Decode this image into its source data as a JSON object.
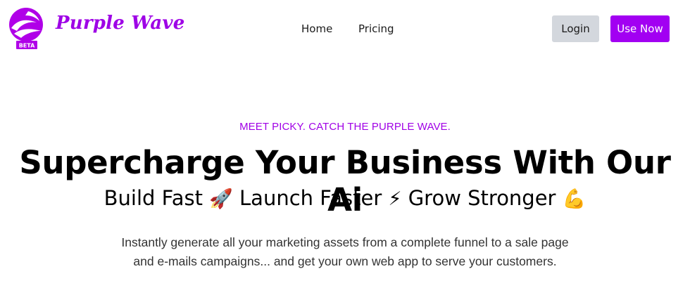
{
  "brand": {
    "name": "Purple Wave",
    "badge": "BETA",
    "logo_icon": "purple-wave-logo-icon",
    "color": "#9e00e6"
  },
  "nav": {
    "items": [
      {
        "label": "Home"
      },
      {
        "label": "Pricing"
      }
    ]
  },
  "actions": {
    "login_label": "Login",
    "use_now_label": "Use Now",
    "accent_color": "#a200f2",
    "login_bg_color": "#d3d7dd"
  },
  "hero": {
    "eyebrow": "MEET PICKY. CATCH THE PURPLE WAVE.",
    "headline": "Supercharge Your Business With Our Ai",
    "sub_parts": [
      {
        "text": "Build Fast",
        "emoji": "🚀",
        "icon": "rocket-icon"
      },
      {
        "text": "Launch Faster",
        "emoji": "⚡",
        "icon": "lightning-icon"
      },
      {
        "text": "Grow Stronger",
        "emoji": "💪",
        "icon": "flexed-biceps-icon"
      }
    ],
    "description": "Instantly generate all your marketing assets from a complete funnel to a sale page and e-mails campaigns... and get your own web app to serve your customers."
  }
}
